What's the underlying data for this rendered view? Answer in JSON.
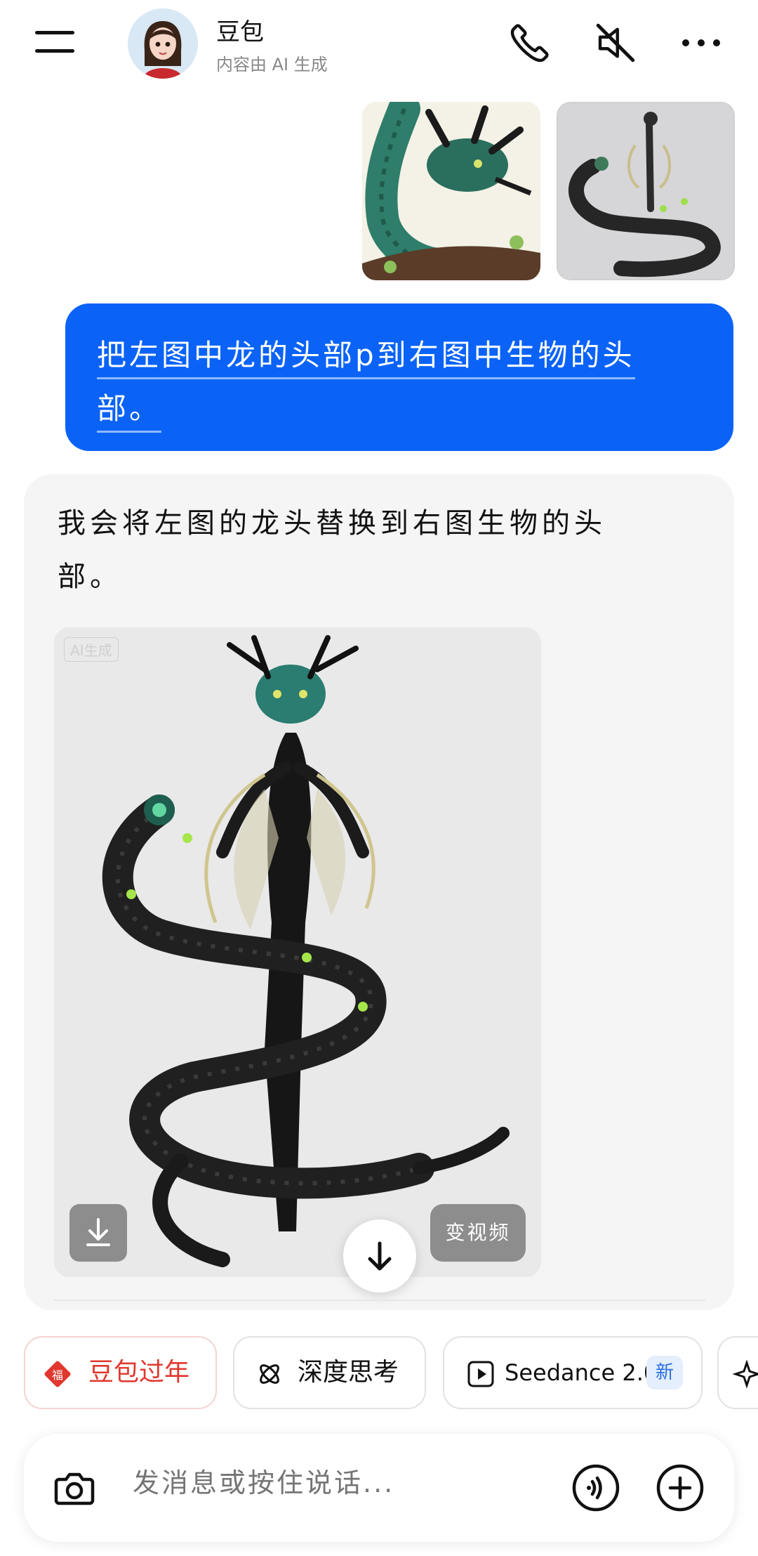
{
  "header": {
    "bot_name": "豆包",
    "subtitle": "内容由 AI 生成"
  },
  "user_message": {
    "line1": "把左图中龙的头部p到右图中生物的头",
    "line2": "部。"
  },
  "bot_message": {
    "line1": "我会将左图的龙头替换到右图生物的头",
    "line2": "部。",
    "ai_tag": "AI生成",
    "to_video_label": "变视频"
  },
  "chips": [
    {
      "label": "豆包过年",
      "icon": "fu-diamond-icon",
      "color": "#e0382e"
    },
    {
      "label": "深度思考",
      "icon": "atom-icon"
    },
    {
      "label": "Seedance 2.0",
      "badge": "新",
      "icon": "play-icon"
    }
  ],
  "input": {
    "placeholder": "发消息或按住说话..."
  },
  "colors": {
    "accent": "#0a63f6",
    "bot_bubble": "#f5f5f5",
    "festive": "#e0382e"
  }
}
